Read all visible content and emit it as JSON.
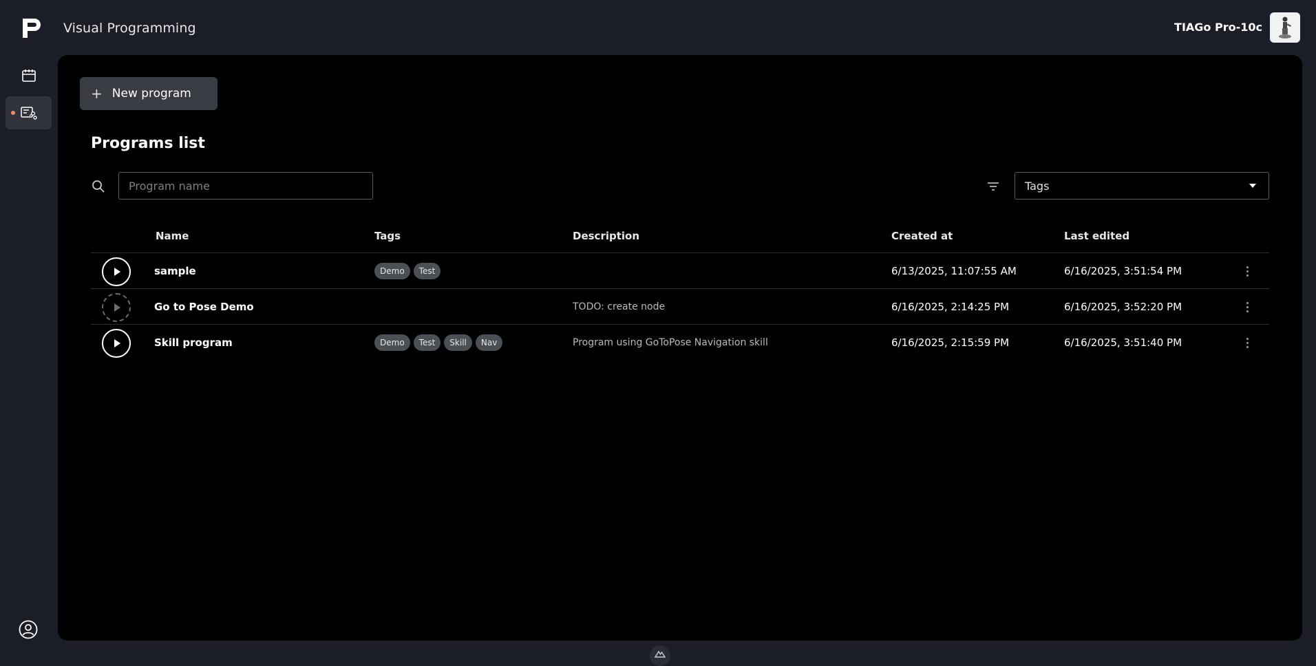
{
  "header": {
    "app_title": "Visual Programming",
    "robot_name": "TIAGo Pro-10c"
  },
  "sidebar": {
    "items": [
      {
        "icon": "calendar-icon",
        "active": false
      },
      {
        "icon": "program-flow-icon",
        "active": true
      }
    ],
    "user_icon": "user-circle-icon",
    "accent_color": "#f08b5a"
  },
  "toolbar": {
    "new_program_label": "New program"
  },
  "programs": {
    "title": "Programs list",
    "search_placeholder": "Program name",
    "tags_placeholder": "Tags",
    "columns": {
      "name": "Name",
      "tags": "Tags",
      "description": "Description",
      "created": "Created at",
      "edited": "Last edited"
    },
    "rows": [
      {
        "name": "sample",
        "tags": [
          "Demo",
          "Test"
        ],
        "description": "",
        "created": "6/13/2025, 11:07:55 AM",
        "edited": "6/16/2025, 3:51:54 PM",
        "runnable": true
      },
      {
        "name": "Go to Pose Demo",
        "tags": [],
        "description": "TODO: create node",
        "created": "6/16/2025, 2:14:25 PM",
        "edited": "6/16/2025, 3:52:20 PM",
        "runnable": false
      },
      {
        "name": "Skill program",
        "tags": [
          "Demo",
          "Test",
          "Skill",
          "Nav"
        ],
        "description": "Program using GoToPose Navigation skill",
        "created": "6/16/2025, 2:15:59 PM",
        "edited": "6/16/2025, 3:51:40 PM",
        "runnable": true
      }
    ]
  }
}
